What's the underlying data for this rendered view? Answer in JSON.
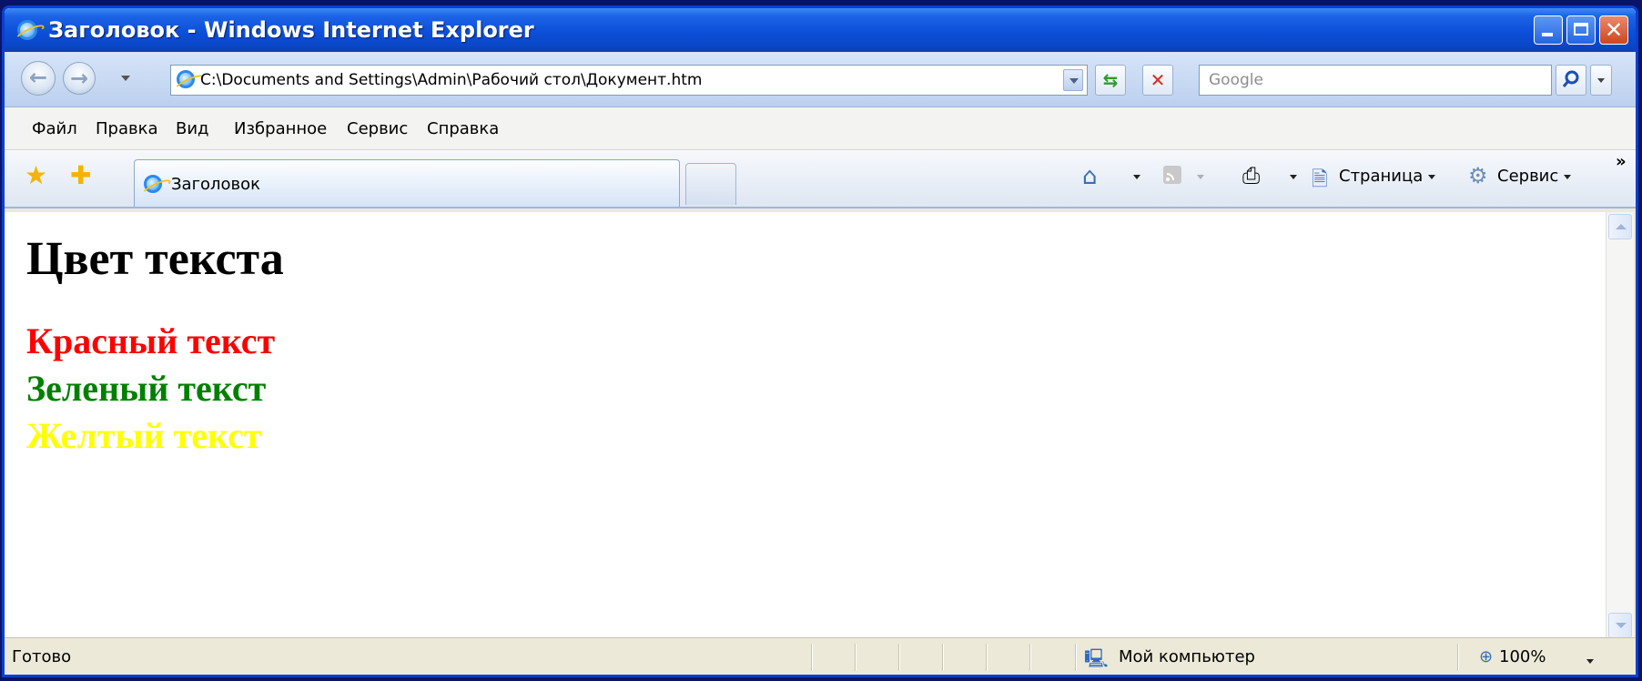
{
  "window": {
    "title": "Заголовок - Windows Internet Explorer"
  },
  "address_bar": {
    "url": "C:\\Documents and Settings\\Admin\\Рабочий стол\\Документ.htm"
  },
  "search": {
    "placeholder": "Google"
  },
  "menu": {
    "items": [
      "Файл",
      "Правка",
      "Вид",
      "Избранное",
      "Сервис",
      "Справка"
    ]
  },
  "tab": {
    "title": "Заголовок"
  },
  "command_bar": {
    "page_label": "Страница",
    "tools_label": "Сервис"
  },
  "page": {
    "heading": "Цвет текста",
    "lines": [
      {
        "text": "Красный текст",
        "color": "#ff0000"
      },
      {
        "text": "Зеленый текст",
        "color": "#008000"
      },
      {
        "text": "Желтый текст",
        "color": "#ffff00"
      }
    ]
  },
  "status": {
    "text": "Готово",
    "zone": "Мой компьютер",
    "zoom": "100%"
  }
}
